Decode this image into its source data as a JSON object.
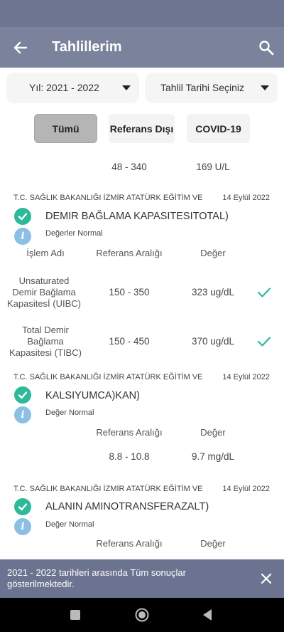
{
  "app_bar": {
    "title": "Tahlillerim",
    "back_icon": "arrow-left-icon",
    "search_icon": "search-icon"
  },
  "filters": {
    "year": "Yıl: 2021 - 2022",
    "date": "Tahlil Tarihi Seçiniz"
  },
  "tabs": [
    {
      "label": "Tümü",
      "active": true
    },
    {
      "label": "Referans Dışı",
      "active": false
    },
    {
      "label": "COVID-19",
      "active": false
    }
  ],
  "partial_row": {
    "range": "48 - 340",
    "value": "169 U/L"
  },
  "cards": [
    {
      "hospital": "T.C. SAĞLIK BAKANLIĞI İZMİR ATATÜRK EĞİTİM VE",
      "date": "14 Eylül 2022",
      "test_name": "DEMIR BAĞLAMA KAPASITESITOTAL)",
      "status": "Değerler Normal",
      "headers": {
        "name": "İşlem Adı",
        "range": "Referans Aralığı",
        "value": "Değer"
      },
      "rows": [
        {
          "name": "Unsaturated Demir Bağlama Kapasitesİ (UIBC)",
          "range": "150 - 350",
          "value": "323 ug/dL"
        },
        {
          "name": "Total Demir Bağlama Kapasitesi (TIBC)",
          "range": "150 - 450",
          "value": "370 ug/dL"
        }
      ]
    },
    {
      "hospital": "T.C. SAĞLIK BAKANLIĞI İZMİR ATATÜRK EĞİTİM VE",
      "date": "14 Eylül 2022",
      "test_name": "KALSIYUMCA)KAN)",
      "status": "Değer Normal",
      "headers": {
        "range": "Referans Aralığı",
        "value": "Değer"
      },
      "rows": [
        {
          "range": "8.8 - 10.8",
          "value": "9.7 mg/dL"
        }
      ]
    },
    {
      "hospital": "T.C. SAĞLIK BAKANLIĞI İZMİR ATATÜRK EĞİTİM VE",
      "date": "14 Eylül 2022",
      "test_name": "ALANIN AMINOTRANSFERAZALT)",
      "status": "Değer Normal",
      "headers": {
        "range": "Referans Aralığı",
        "value": "Değer"
      }
    }
  ],
  "snackbar": {
    "message": "2021 - 2022 tarihleri arasında Tüm sonuçlar gösterilmektedir.",
    "close_icon": "close-icon"
  },
  "colors": {
    "app_bar": "#7a829c",
    "status_bar": "#6e7591",
    "check": "#2db99a",
    "info": "#8bbfe3",
    "snackbar": "#6c7390"
  }
}
